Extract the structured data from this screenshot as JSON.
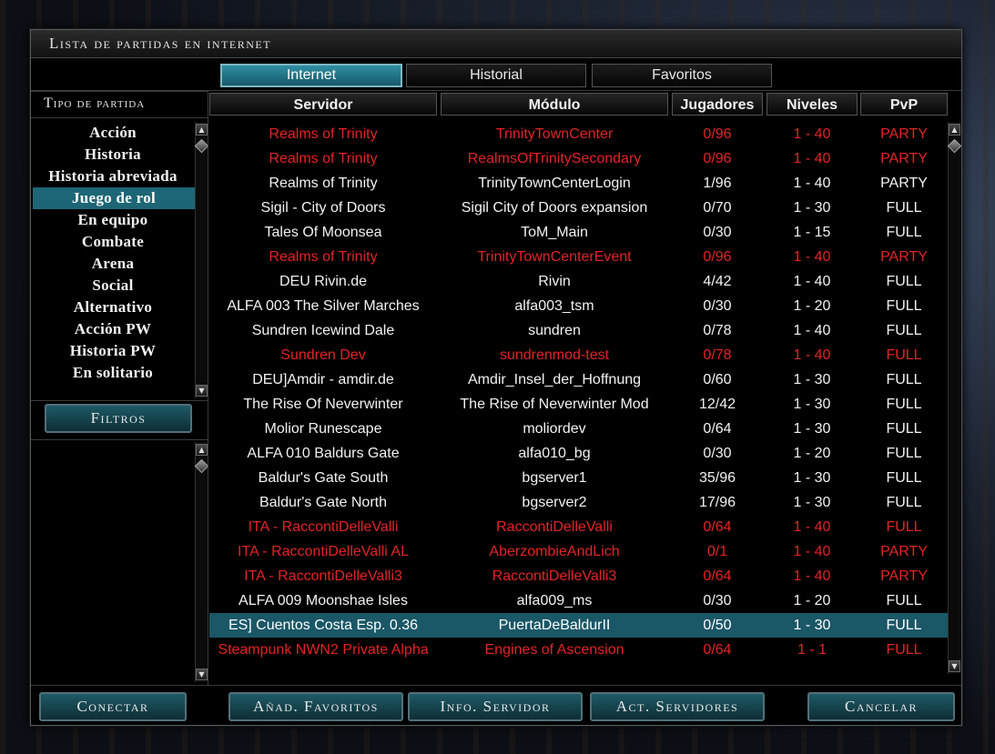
{
  "window": {
    "title": "Lista de partidas en internet"
  },
  "tabs": [
    {
      "label": "Internet",
      "active": true
    },
    {
      "label": "Historial",
      "active": false
    },
    {
      "label": "Favoritos",
      "active": false
    }
  ],
  "game_types": {
    "header": "Tipo de partida",
    "selected_index": 3,
    "items": [
      "Acción",
      "Historia",
      "Historia abreviada",
      "Juego de rol",
      "En equipo",
      "Combate",
      "Arena",
      "Social",
      "Alternativo",
      "Acción PW",
      "Historia PW",
      "En solitario"
    ]
  },
  "filters_button": "Filtros",
  "columns": [
    "Servidor",
    "Módulo",
    "Jugadores",
    "Niveles",
    "PvP"
  ],
  "servers": [
    {
      "server": "Realms of Trinity",
      "module": "TrinityTownCenter",
      "players": "0/96",
      "levels": "1 - 40",
      "pvp": "PARTY",
      "style": "red"
    },
    {
      "server": "Realms of Trinity",
      "module": "RealmsOfTrinitySecondary",
      "players": "0/96",
      "levels": "1 - 40",
      "pvp": "PARTY",
      "style": "red"
    },
    {
      "server": "Realms of Trinity",
      "module": "TrinityTownCenterLogin",
      "players": "1/96",
      "levels": "1 - 40",
      "pvp": "PARTY",
      "style": "normal"
    },
    {
      "server": "Sigil - City of Doors",
      "module": "Sigil City of Doors expansion",
      "players": "0/70",
      "levels": "1 - 30",
      "pvp": "FULL",
      "style": "normal"
    },
    {
      "server": "Tales Of Moonsea",
      "module": "ToM_Main",
      "players": "0/30",
      "levels": "1 - 15",
      "pvp": "FULL",
      "style": "normal"
    },
    {
      "server": "Realms of Trinity",
      "module": "TrinityTownCenterEvent",
      "players": "0/96",
      "levels": "1 - 40",
      "pvp": "PARTY",
      "style": "red"
    },
    {
      "server": "DEU Rivin.de",
      "module": "Rivin",
      "players": "4/42",
      "levels": "1 - 40",
      "pvp": "FULL",
      "style": "normal"
    },
    {
      "server": "ALFA 003 The Silver Marches",
      "module": "alfa003_tsm",
      "players": "0/30",
      "levels": "1 - 20",
      "pvp": "FULL",
      "style": "normal"
    },
    {
      "server": "Sundren  Icewind Dale",
      "module": "sundren",
      "players": "0/78",
      "levels": "1 - 40",
      "pvp": "FULL",
      "style": "normal"
    },
    {
      "server": "Sundren Dev",
      "module": "sundrenmod-test",
      "players": "0/78",
      "levels": "1 - 40",
      "pvp": "FULL",
      "style": "red"
    },
    {
      "server": "DEU]Amdir - amdir.de",
      "module": "Amdir_Insel_der_Hoffnung",
      "players": "0/60",
      "levels": "1 - 30",
      "pvp": "FULL",
      "style": "normal"
    },
    {
      "server": "The Rise Of Neverwinter",
      "module": "The Rise of Neverwinter Mod",
      "players": "12/42",
      "levels": "1 - 30",
      "pvp": "FULL",
      "style": "normal"
    },
    {
      "server": "Molior Runescape",
      "module": "moliordev",
      "players": "0/64",
      "levels": "1 - 30",
      "pvp": "FULL",
      "style": "normal"
    },
    {
      "server": "ALFA 010 Baldurs Gate",
      "module": "alfa010_bg",
      "players": "0/30",
      "levels": "1 - 20",
      "pvp": "FULL",
      "style": "normal"
    },
    {
      "server": "Baldur's Gate South",
      "module": "bgserver1",
      "players": "35/96",
      "levels": "1 - 30",
      "pvp": "FULL",
      "style": "normal"
    },
    {
      "server": "Baldur's Gate North",
      "module": "bgserver2",
      "players": "17/96",
      "levels": "1 - 30",
      "pvp": "FULL",
      "style": "normal"
    },
    {
      "server": "ITA - RaccontiDelleValli",
      "module": "RaccontiDelleValli",
      "players": "0/64",
      "levels": "1 - 40",
      "pvp": "FULL",
      "style": "red"
    },
    {
      "server": "ITA - RaccontiDelleValli AL",
      "module": "AberzombieAndLich",
      "players": "0/1",
      "levels": "1 - 40",
      "pvp": "PARTY",
      "style": "red"
    },
    {
      "server": "ITA - RaccontiDelleValli3",
      "module": "RaccontiDelleValli3",
      "players": "0/64",
      "levels": "1 - 40",
      "pvp": "PARTY",
      "style": "red"
    },
    {
      "server": "ALFA 009 Moonshae Isles",
      "module": "alfa009_ms",
      "players": "0/30",
      "levels": "1 - 20",
      "pvp": "FULL",
      "style": "normal"
    },
    {
      "server": "ES] Cuentos Costa Esp. 0.36",
      "module": "PuertaDeBaldurII",
      "players": "0/50",
      "levels": "1 - 30",
      "pvp": "FULL",
      "style": "selected"
    },
    {
      "server": "Steampunk NWN2 Private Alpha",
      "module": "Engines of Ascension",
      "players": "0/64",
      "levels": "1 - 1",
      "pvp": "FULL",
      "style": "red"
    }
  ],
  "buttons": {
    "connect": "Conectar",
    "add_favorites": "Añad. Favoritos",
    "server_info": "Info. Servidor",
    "refresh_servers": "Act. Servidores",
    "cancel": "Cancelar"
  },
  "colors": {
    "accent": "#1d6676",
    "unavailable_text": "#e42424"
  }
}
